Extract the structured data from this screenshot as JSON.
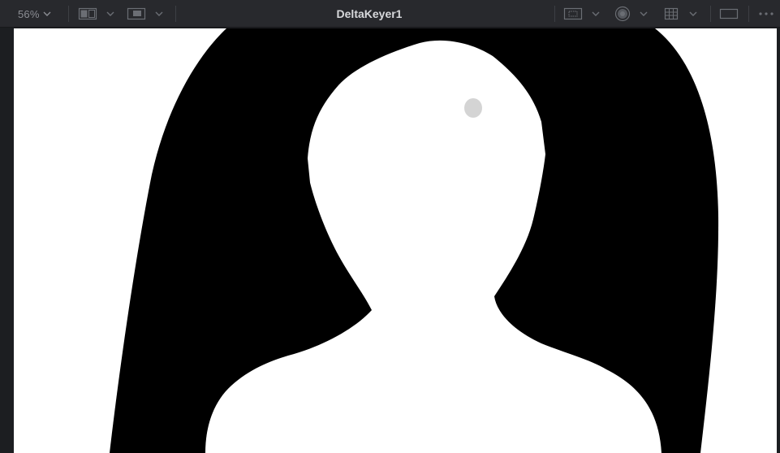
{
  "viewer": {
    "title": "DeltaKeyer1",
    "zoom": "56%"
  },
  "toolbar": {
    "left_buttons": [
      {
        "icon": "zoom-dropdown"
      },
      {
        "icon": "split-view-icon"
      },
      {
        "icon": "single-view-icon"
      }
    ],
    "right_buttons": [
      {
        "icon": "roi-icon"
      },
      {
        "icon": "checker-icon"
      },
      {
        "icon": "grid-icon"
      },
      {
        "icon": "frame-icon"
      },
      {
        "icon": "more-icon"
      }
    ]
  },
  "colors": {
    "toolbar_bg": "#28292d",
    "matte_black": "#000000",
    "matte_white": "#ffffff",
    "icon": "#6b6e74"
  }
}
